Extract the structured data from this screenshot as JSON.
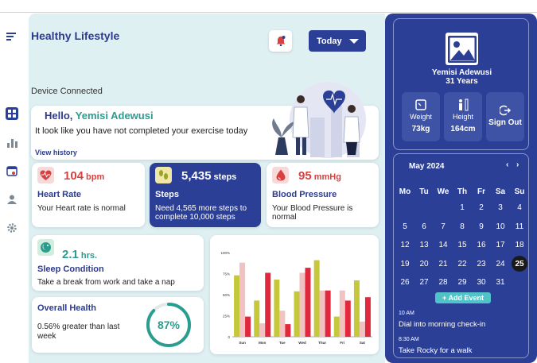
{
  "app": {
    "title": "Healthy Lifestyle",
    "filter": "Today",
    "device_status": "Device Connected"
  },
  "greeting": {
    "hello": "Hello,",
    "name": "Yemisi Adewusi",
    "message": "It look like you have not completed your exercise today",
    "link": "View history"
  },
  "metrics": {
    "heart": {
      "value": "104",
      "unit": "bpm",
      "label": "Heart Rate",
      "desc": "Your Heart rate is normal",
      "color": "#d8413f"
    },
    "steps": {
      "value": "5,435",
      "unit": "steps",
      "label": "Steps",
      "desc": "Need 4,565 more steps to complete 10,000 steps",
      "color": "#2b3f96"
    },
    "blood": {
      "value": "95",
      "unit": "mmHg",
      "label": "Blood Pressure",
      "desc": "Your Blood Pressure is normal",
      "color": "#d8413f"
    }
  },
  "sleep": {
    "value": "2.1",
    "unit": "hrs.",
    "label": "Sleep Condition",
    "desc": "Take a break from work and take a nap",
    "color": "#2a9d8f"
  },
  "overall": {
    "label": "Overall Health",
    "desc": "0.56% greater than last week",
    "percent": 87,
    "percent_label": "87%"
  },
  "profile": {
    "name": "Yemisi Adewusi",
    "age": "31 Years",
    "weight": {
      "label": "Weight",
      "value": "73kg"
    },
    "height": {
      "label": "Height",
      "value": "164cm"
    },
    "signout": "Sign Out"
  },
  "calendar": {
    "month": "May 2024",
    "prev": "‹",
    "next": "›",
    "weekdays": [
      "Mo",
      "Tu",
      "We",
      "Th",
      "Fr",
      "Sa",
      "Su"
    ],
    "weeks": [
      [
        "",
        "",
        "1",
        "2",
        "3",
        "4"
      ],
      [
        "5",
        "6",
        "7",
        "8",
        "9",
        "10",
        "11"
      ],
      [
        "12",
        "13",
        "14",
        "15",
        "16",
        "17",
        "18"
      ],
      [
        "19",
        "20",
        "21",
        "22",
        "23",
        "24",
        "25"
      ],
      [
        "26",
        "27",
        "28",
        "29",
        "30",
        "31",
        ""
      ]
    ],
    "selected": "25",
    "add_event": "+ Add Event",
    "events": [
      {
        "time": "10 AM",
        "title": "Dial into morning check-in"
      },
      {
        "time": "8:30 AM",
        "title": "Take Rocky for a walk"
      }
    ]
  },
  "chart_data": {
    "type": "bar",
    "categories": [
      "Sun",
      "Mon",
      "Tue",
      "Wed",
      "Thur",
      "Fri",
      "Sat"
    ],
    "ytick_labels": [
      "0",
      "25%",
      "50%",
      "75%",
      "100%"
    ],
    "ylim": [
      0,
      100
    ],
    "series": [
      {
        "color": "#c5c83a",
        "values": [
          73,
          43,
          68,
          54,
          91,
          24,
          67
        ]
      },
      {
        "color": "#f2c2c2",
        "values": [
          88,
          16,
          31,
          76,
          55,
          55,
          18
        ]
      },
      {
        "color": "#e0293c",
        "values": [
          24,
          76,
          15,
          82,
          55,
          43,
          47
        ]
      }
    ]
  }
}
